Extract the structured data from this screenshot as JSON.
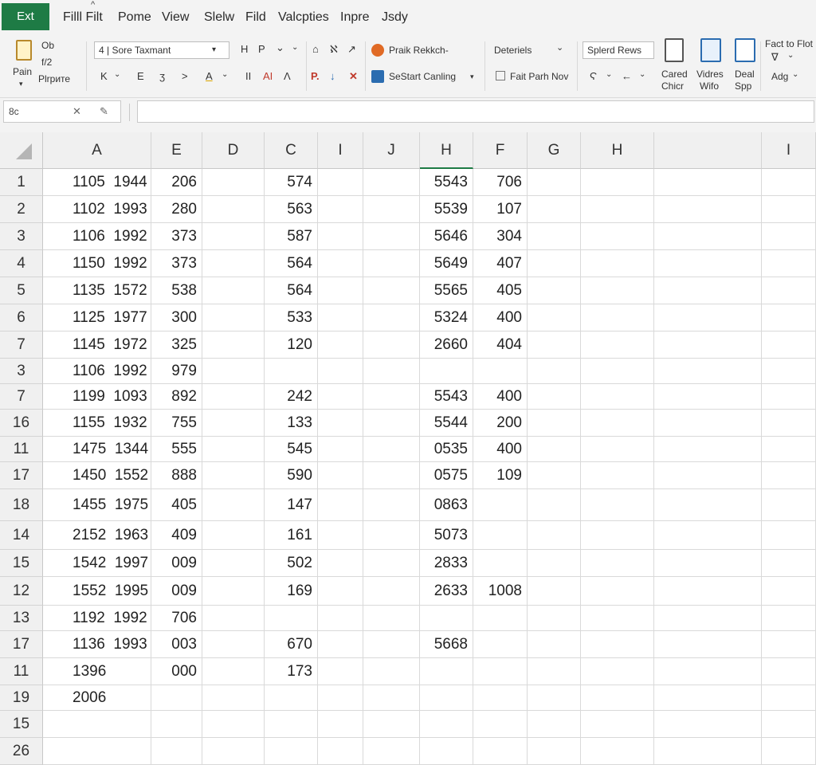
{
  "app": {
    "tab_label": "Ext",
    "accent_color": "#1e7b45"
  },
  "menu": {
    "items": [
      "Filll Filt",
      "Pome",
      "Viеw",
      "Slelw",
      "Fild",
      "Valcpties",
      "Inpre",
      "Jsdy"
    ],
    "caret_mark": "^"
  },
  "ribbon": {
    "clipboard": {
      "top_label": "Ob",
      "mid_label": "f/2",
      "paste_label": "Pain",
      "painter_label": "Plrpите",
      "paste_caret": "▾"
    },
    "font": {
      "font_box": "4 | Sore Taxmant",
      "row1_glyphs": [
        "H",
        "Ρ",
        "⌄",
        "⌄"
      ],
      "row2_glyphs": [
        "K",
        "⌄",
        "Ε",
        "ʒ",
        ">",
        "A",
        "⌄"
      ]
    },
    "alignment": {
      "row1_glyphs": [
        "⌂",
        "ℵ",
        "↗"
      ],
      "row2_glyphs": [
        "ΙΙ",
        "ΑΙ",
        "Λ"
      ]
    },
    "number": {
      "style_label": "Praik Rekkch-",
      "row2_glyphs": [
        "P.",
        "↓",
        "✕"
      ],
      "start_label": "SeStart Canling",
      "start_caret": "▾"
    },
    "styles": {
      "label1": "Deteriels",
      "label1_caret": "⌄",
      "label2": "Fait Parh Nov",
      "row2_glyphs": [
        "Ϛ",
        "⌄",
        "←",
        "⌄"
      ]
    },
    "cells": {
      "select_box": "Splerd Rews",
      "items": [
        {
          "line1": "Cared",
          "line2": "Chicr"
        },
        {
          "line1": "Vidres",
          "line2": "Wifo"
        },
        {
          "line1": "Deal",
          "line2": "Spp"
        }
      ]
    },
    "editing": {
      "top_label": "Fact to Flot",
      "filter_glyph": "∇",
      "filter_caret": "⌄",
      "add_label": "Adg",
      "add_caret": "⌄"
    }
  },
  "formula_bar": {
    "name_box": "8c",
    "cancel_glyph": "✕",
    "edit_glyph": "✎"
  },
  "grid": {
    "columns": [
      "A",
      "E",
      "D",
      "C",
      "I",
      "J",
      "H",
      "F",
      "G",
      "H",
      "",
      "I"
    ],
    "active_column_index": 6,
    "rows": [
      {
        "label": "1",
        "cells": [
          "1105  1944",
          "206",
          "",
          "574",
          "",
          "",
          "5543",
          "706",
          "",
          "",
          "",
          ""
        ]
      },
      {
        "label": "2",
        "cells": [
          "1102  1993",
          "280",
          "",
          "563",
          "",
          "",
          "5539",
          "107",
          "",
          "",
          "",
          ""
        ]
      },
      {
        "label": "3",
        "cells": [
          "1106  1992",
          "373",
          "",
          "587",
          "",
          "",
          "5646",
          "304",
          "",
          "",
          "",
          ""
        ]
      },
      {
        "label": "4",
        "cells": [
          "1150  1992",
          "373",
          "",
          "564",
          "",
          "",
          "5649",
          "407",
          "",
          "",
          "",
          ""
        ]
      },
      {
        "label": "5",
        "cells": [
          "1135  1572",
          "538",
          "",
          "564",
          "",
          "",
          "5565",
          "405",
          "",
          "",
          "",
          ""
        ]
      },
      {
        "label": "6",
        "cells": [
          "1125  1977",
          "300",
          "",
          "533",
          "",
          "",
          "5324",
          "400",
          "",
          "",
          "",
          ""
        ]
      },
      {
        "label": "7",
        "cells": [
          "1145  1972",
          "325",
          "",
          "120",
          "",
          "",
          "2660",
          "404",
          "",
          "",
          "",
          ""
        ]
      },
      {
        "label": "3",
        "cells": [
          "1106  1992",
          "979",
          "",
          "",
          "",
          "",
          "",
          "",
          "",
          "",
          "",
          ""
        ]
      },
      {
        "label": "7",
        "cells": [
          "1199  1093",
          "892",
          "",
          "242",
          "",
          "",
          "5543",
          "400",
          "",
          "",
          "",
          ""
        ]
      },
      {
        "label": "16",
        "cells": [
          "1155  1932",
          "755",
          "",
          "133",
          "",
          "",
          "5544",
          "200",
          "",
          "",
          "",
          ""
        ]
      },
      {
        "label": "11",
        "cells": [
          "1475  1344",
          "555",
          "",
          "545",
          "",
          "",
          "0535",
          "400",
          "",
          "",
          "",
          ""
        ]
      },
      {
        "label": "17",
        "cells": [
          "1450  1552",
          "888",
          "",
          "590",
          "",
          "",
          "0575",
          "109",
          "",
          "",
          "",
          ""
        ]
      },
      {
        "label": "18",
        "cells": [
          "1455  1975",
          "405",
          "",
          "147",
          "",
          "",
          "0863",
          "",
          "",
          "",
          "",
          ""
        ]
      },
      {
        "label": "14",
        "cells": [
          "2152  1963",
          "409",
          "",
          "161",
          "",
          "",
          "5073",
          "",
          "",
          "",
          "",
          ""
        ]
      },
      {
        "label": "15",
        "cells": [
          "1542  1997",
          "009",
          "",
          "502",
          "",
          "",
          "2833",
          "",
          "",
          "",
          "",
          ""
        ]
      },
      {
        "label": "12",
        "cells": [
          "1552  1995",
          "009",
          "",
          "169",
          "",
          "",
          "2633",
          "1008",
          "",
          "",
          "",
          ""
        ]
      },
      {
        "label": "13",
        "cells": [
          "1192  1992",
          "706",
          "",
          "",
          "",
          "",
          "",
          "",
          "",
          "",
          "",
          ""
        ]
      },
      {
        "label": "17",
        "cells": [
          "1136  1993",
          "003",
          "",
          "670",
          "",
          "",
          "5668",
          "",
          "",
          "",
          "",
          ""
        ]
      },
      {
        "label": "11",
        "cells": [
          "1396",
          "000",
          "",
          "173",
          "",
          "",
          "",
          "",
          "",
          "",
          "",
          ""
        ]
      },
      {
        "label": "19",
        "cells": [
          "2006",
          "",
          "",
          "",
          "",
          "",
          "",
          "",
          "",
          "",
          "",
          ""
        ]
      },
      {
        "label": "15",
        "cells": [
          "",
          "",
          "",
          "",
          "",
          "",
          "",
          "",
          "",
          "",
          "",
          ""
        ]
      },
      {
        "label": "26",
        "cells": [
          "",
          "",
          "",
          "",
          "",
          "",
          "",
          "",
          "",
          "",
          "",
          ""
        ]
      }
    ]
  }
}
